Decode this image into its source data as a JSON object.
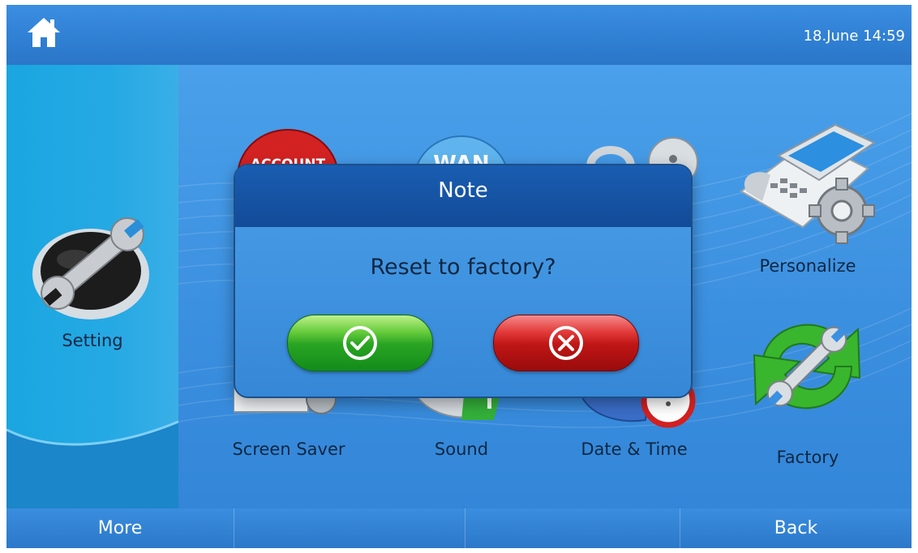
{
  "header": {
    "datetime": "18.June 14:59",
    "home_icon": "home-icon"
  },
  "sidebar": {
    "label": "Setting",
    "icon": "wrench-icon"
  },
  "tiles": [
    {
      "name": "account",
      "icon": "account-icon",
      "badge": "ACCOUNT"
    },
    {
      "name": "wan",
      "icon": "globe-icon",
      "badge": "WAN"
    },
    {
      "name": "security",
      "icon": "lock-icon"
    },
    {
      "name": "personalize",
      "label": "Personalize",
      "icon": "desk-phone-gear-icon"
    },
    {
      "name": "screen-saver",
      "label": "Screen Saver",
      "icon": "screen-gear-icon"
    },
    {
      "name": "sound",
      "label": "Sound",
      "icon": "speaker-icon"
    },
    {
      "name": "date-time",
      "label": "Date & Time",
      "icon": "clock-icon"
    },
    {
      "name": "factory",
      "label": "Factory",
      "icon": "refresh-wrench-icon"
    }
  ],
  "dialog": {
    "title": "Note",
    "message": "Reset to factory?",
    "confirm_icon": "check-circle-icon",
    "cancel_icon": "x-circle-icon"
  },
  "bottombar": {
    "left": "More",
    "right": "Back"
  },
  "colors": {
    "accent_blue": "#2f82d6",
    "dialog_header": "#124b98",
    "confirm_green": "#2aa423",
    "cancel_red": "#c01616"
  }
}
